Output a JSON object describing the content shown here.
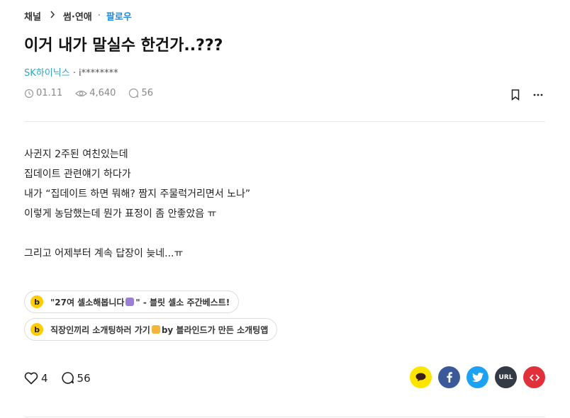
{
  "breadcrumb": {
    "channel": "채널",
    "topic": "썸·연애",
    "follow": "팔로우"
  },
  "post": {
    "title": "이거 내가 말실수 한건가..???",
    "company": "SK하이닉스",
    "author_sep": " · ",
    "author": "i********",
    "date": "01.11",
    "views": "4,640",
    "comments_count": "56",
    "lines": [
      "사귄지 2주된 여친있는데",
      "집데이트 관련얘기 하다가",
      "내가 “집데이트 하면 뭐해? 짬지 주물럭거리면서 노나”",
      "이렇게 농담했는데 뭔가 표정이 좀 안좋았음 ㅠ",
      "",
      "그리고 어제부터 계속 답장이 늦네...ㅠ"
    ]
  },
  "tags": [
    {
      "logo": "b",
      "before": "\"27여 셀소해봅니다",
      "after": "\" - 블릿 셀소 주간베스트!",
      "emoji_color": "#9b7fd4"
    },
    {
      "logo": "b",
      "before": "직장인끼리 소개팅하러 가기",
      "after": " by 블라인드가 만든 소개팅앱",
      "emoji_color": "#f5b43a"
    }
  ],
  "reactions": {
    "likes": "4",
    "comments": "56"
  },
  "share": {
    "kakao_color": "#fee500",
    "facebook_color": "#3b5998",
    "twitter_color": "#1da1f2",
    "url_color": "#333a45",
    "url_label": "URL",
    "embed_color": "#e0303a"
  }
}
